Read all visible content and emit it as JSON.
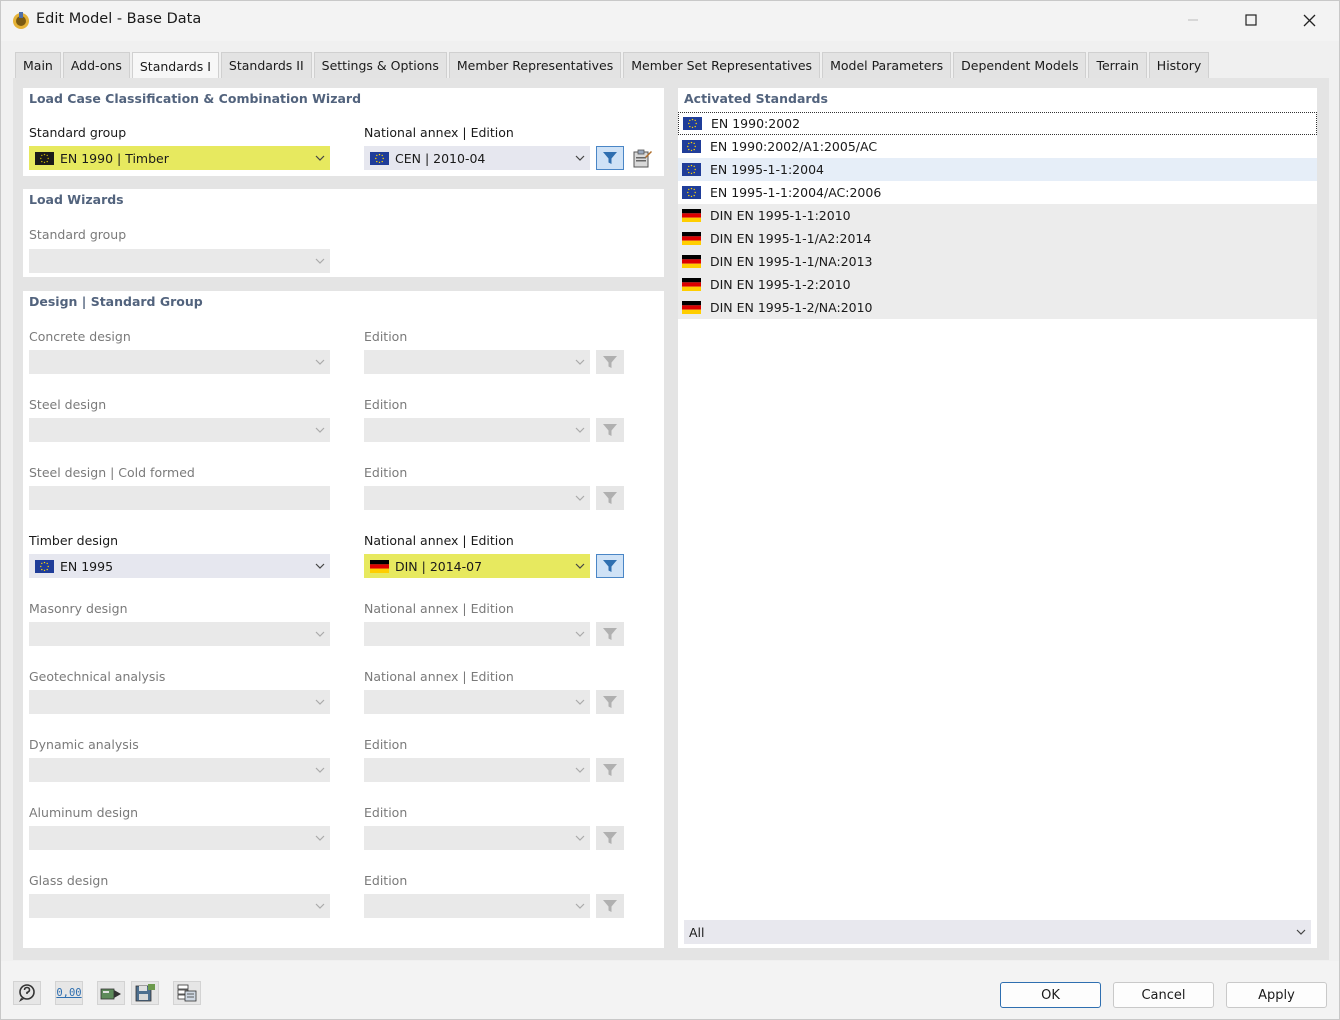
{
  "window": {
    "title": "Edit Model - Base Data"
  },
  "tabs": [
    {
      "label": "Main"
    },
    {
      "label": "Add-ons"
    },
    {
      "label": "Standards I"
    },
    {
      "label": "Standards II"
    },
    {
      "label": "Settings & Options"
    },
    {
      "label": "Member Representatives"
    },
    {
      "label": "Member Set Representatives"
    },
    {
      "label": "Model Parameters"
    },
    {
      "label": "Dependent Models"
    },
    {
      "label": "Terrain"
    },
    {
      "label": "History"
    }
  ],
  "active_tab": "Standards I",
  "load_case_wizard": {
    "title": "Load Case Classification & Combination Wizard",
    "standard_group_label": "Standard group",
    "standard_group_value": "EN 1990 | Timber",
    "national_annex_label": "National annex | Edition",
    "national_annex_value": "CEN | 2010-04"
  },
  "load_wizards": {
    "title": "Load Wizards",
    "standard_group_label": "Standard group",
    "standard_group_value": ""
  },
  "design": {
    "title": "Design | Standard Group",
    "rows": [
      {
        "label": "Concrete design",
        "value": "",
        "edition_label": "Edition",
        "edition_value": ""
      },
      {
        "label": "Steel design",
        "value": "",
        "edition_label": "Edition",
        "edition_value": ""
      },
      {
        "label": "Steel design | Cold formed",
        "value": "",
        "edition_label": "Edition",
        "edition_value": ""
      },
      {
        "label": "Timber design",
        "value": "EN 1995",
        "edition_label": "National annex | Edition",
        "edition_value": "DIN | 2014-07"
      },
      {
        "label": "Masonry design",
        "value": "",
        "edition_label": "National annex | Edition",
        "edition_value": ""
      },
      {
        "label": "Geotechnical analysis",
        "value": "",
        "edition_label": "National annex | Edition",
        "edition_value": ""
      },
      {
        "label": "Dynamic analysis",
        "value": "",
        "edition_label": "Edition",
        "edition_value": ""
      },
      {
        "label": "Aluminum design",
        "value": "",
        "edition_label": "Edition",
        "edition_value": ""
      },
      {
        "label": "Glass design",
        "value": "",
        "edition_label": "Edition",
        "edition_value": ""
      }
    ]
  },
  "activated_standards": {
    "title": "Activated Standards",
    "items": [
      {
        "flag": "eu",
        "label": "EN 1990:2002"
      },
      {
        "flag": "eu",
        "label": "EN 1990:2002/A1:2005/AC"
      },
      {
        "flag": "eu",
        "label": "EN 1995-1-1:2004"
      },
      {
        "flag": "eu",
        "label": "EN 1995-1-1:2004/AC:2006"
      },
      {
        "flag": "de",
        "label": "DIN EN 1995-1-1:2010"
      },
      {
        "flag": "de",
        "label": "DIN EN 1995-1-1/A2:2014"
      },
      {
        "flag": "de",
        "label": "DIN EN 1995-1-1/NA:2013"
      },
      {
        "flag": "de",
        "label": "DIN EN 1995-1-2:2010"
      },
      {
        "flag": "de",
        "label": "DIN EN 1995-1-2/NA:2010"
      }
    ],
    "filter_value": "All"
  },
  "footer": {
    "units_icon_text": "0,00",
    "ok_label": "OK",
    "cancel_label": "Cancel",
    "apply_label": "Apply"
  },
  "colors": {
    "highlight_yellow": "#e7e95f",
    "section_title": "#52637d",
    "filter_active": "#4a86c6"
  }
}
